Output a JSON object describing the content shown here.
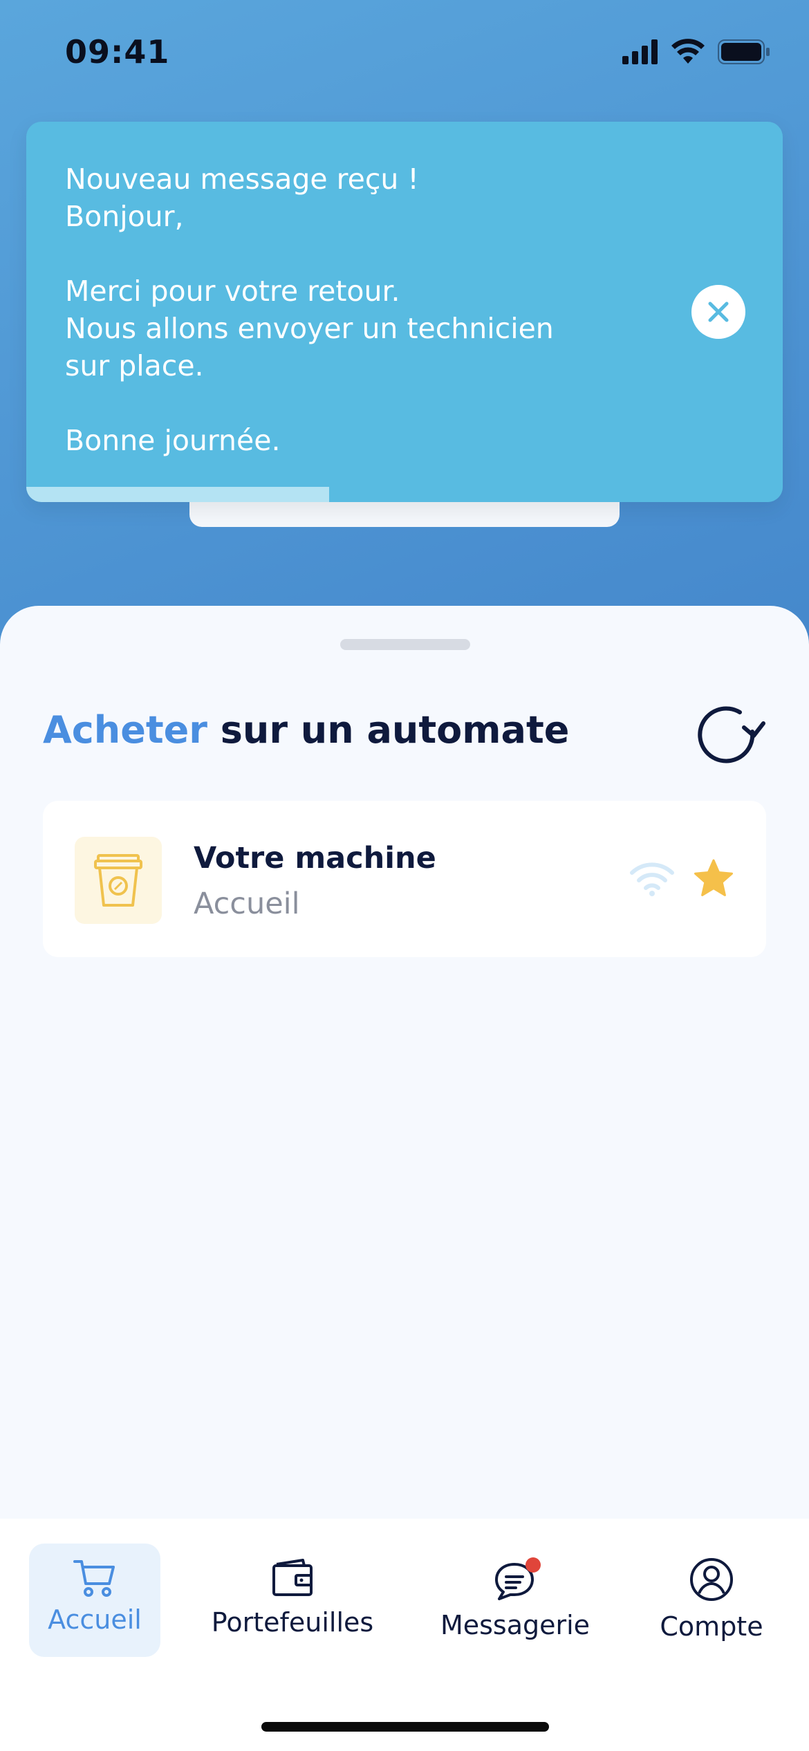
{
  "status_bar": {
    "time": "09:41"
  },
  "toast": {
    "message": "Nouveau message reçu !\nBonjour,\n\nMerci pour votre retour.\nNous allons envoyer un technicien\nsur place.\n\nBonne journée.",
    "progress_fraction": 0.4,
    "close_icon": "close-icon"
  },
  "sheet": {
    "title_accent": "Acheter",
    "title_rest": " sur un automate",
    "refresh_icon": "refresh-icon"
  },
  "machine": {
    "name": "Votre machine",
    "location": "Accueil",
    "icon": "coffee-cup-icon",
    "favorite": true
  },
  "tabs": [
    {
      "label": "Accueil",
      "icon": "cart-icon",
      "active": true
    },
    {
      "label": "Portefeuilles",
      "icon": "wallet-icon",
      "active": false
    },
    {
      "label": "Messagerie",
      "icon": "chat-icon",
      "active": false,
      "badge": true
    },
    {
      "label": "Compte",
      "icon": "user-icon",
      "active": false
    }
  ],
  "colors": {
    "accent": "#4a8ee0",
    "toast_bg": "#58bbe1",
    "star": "#f5c04a",
    "badge": "#e0453a"
  }
}
